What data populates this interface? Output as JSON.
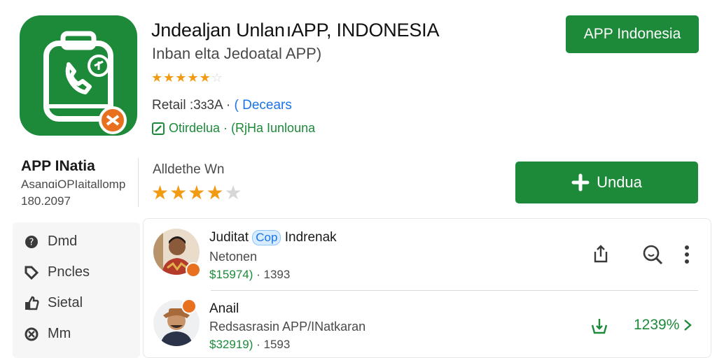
{
  "header": {
    "title": "Jndealjan Unlan ıAPP, INDONESIA",
    "subtitle": "Inban elta Jedoatal APP)",
    "rating_stars": 4.5,
    "retail_label": "Retail :3ɜ3A ·",
    "retail_link": "( Decears",
    "verified_text": "Otirdelua · (RjHa Iunlouna",
    "top_button": "APP Indonesia"
  },
  "info": {
    "brand": "APP INatia",
    "brand_sub": "AsanɑiOPIaitallomp",
    "brand_num": "180.2097",
    "audit_label": "Alldethe Wn",
    "audit_stars": 4,
    "download_button": "Undua"
  },
  "sidebar": {
    "items": [
      {
        "label": "Dmd",
        "icon": "help-circle-icon"
      },
      {
        "label": "Pncles",
        "icon": "tag-icon"
      },
      {
        "label": "Sietal",
        "icon": "thumbs-up-icon"
      },
      {
        "label": "Mm",
        "icon": "settings-icon"
      }
    ]
  },
  "list": {
    "rows": [
      {
        "title_prefix": "Juditat",
        "title_chip": "Cop",
        "title_suffix": "Indrenak",
        "subtitle": "Netonen",
        "price": "$15974)",
        "meta": "· 1393"
      },
      {
        "title": "Anail",
        "subtitle": "Redsasrasin APP/INatkaran",
        "price": "$32919)",
        "meta": "· 1593",
        "percent": "1239%"
      }
    ]
  },
  "colors": {
    "brand_green": "#1d8a3a",
    "star": "#f29a11",
    "link_blue": "#1a73e8",
    "badge_orange": "#e8711f"
  }
}
